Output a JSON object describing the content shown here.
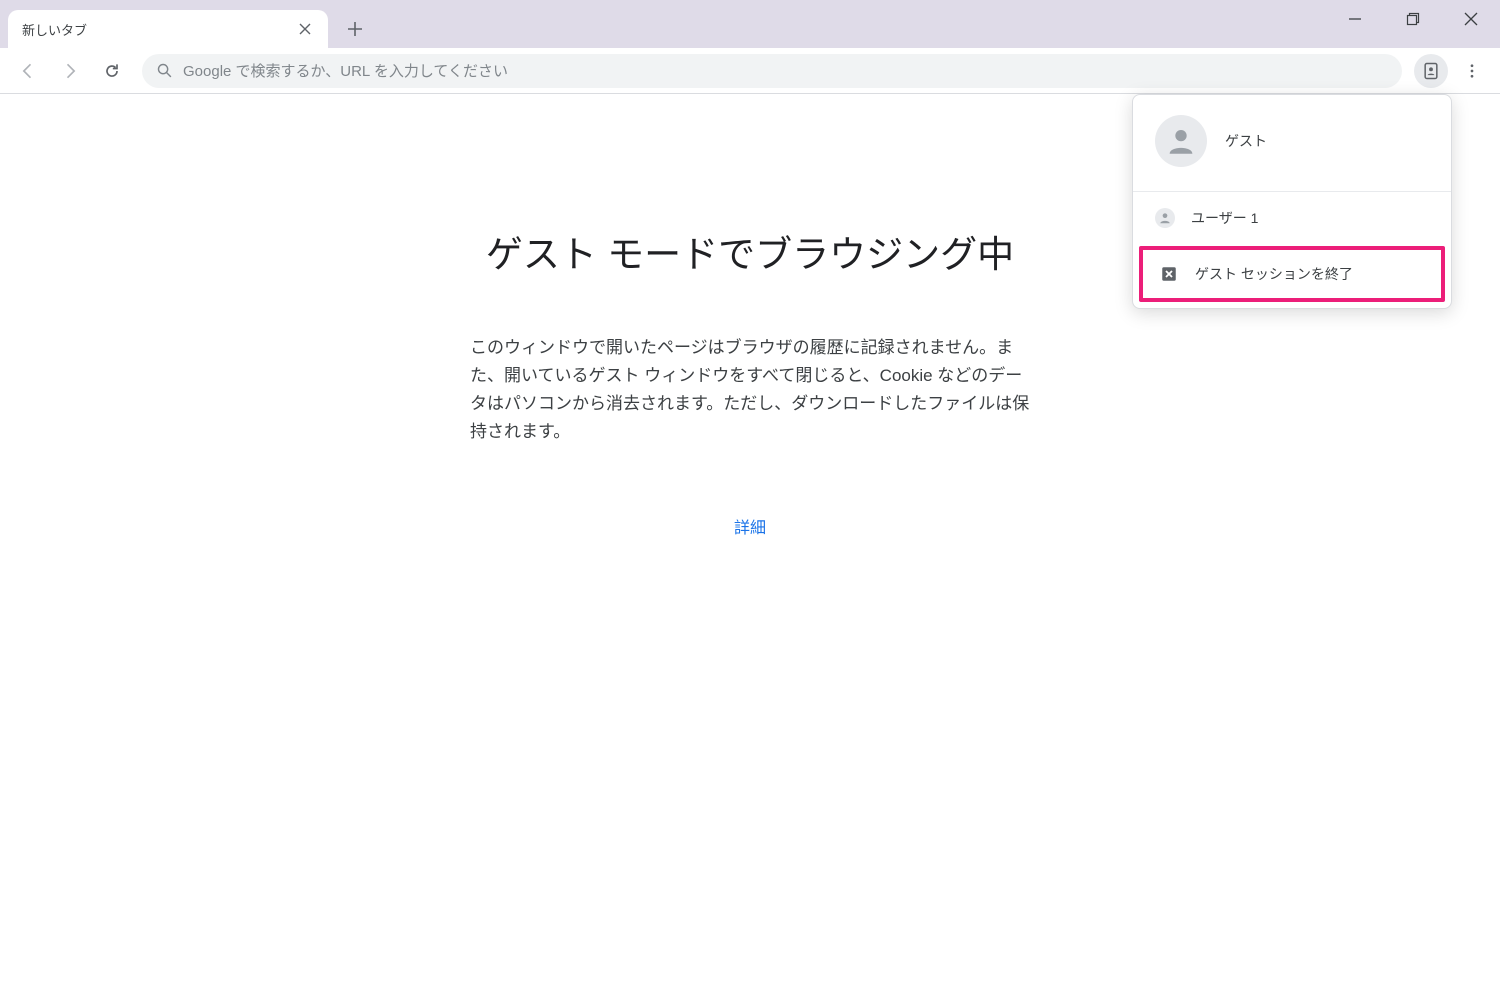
{
  "tab": {
    "title": "新しいタブ"
  },
  "omnibox": {
    "placeholder": "Google で検索するか、URL を入力してください"
  },
  "page": {
    "heading": "ゲスト モードでブラウジング中",
    "description": "このウィンドウで開いたページはブラウザの履歴に記録されません。また、開いているゲスト ウィンドウをすべて閉じると、Cookie などのデータはパソコンから消去されます。ただし、ダウンロードしたファイルは保持されます。",
    "learn_more": "詳細"
  },
  "profile_popup": {
    "guest_label": "ゲスト",
    "user_item": "ユーザー 1",
    "exit_item": "ゲスト セッションを終了"
  }
}
